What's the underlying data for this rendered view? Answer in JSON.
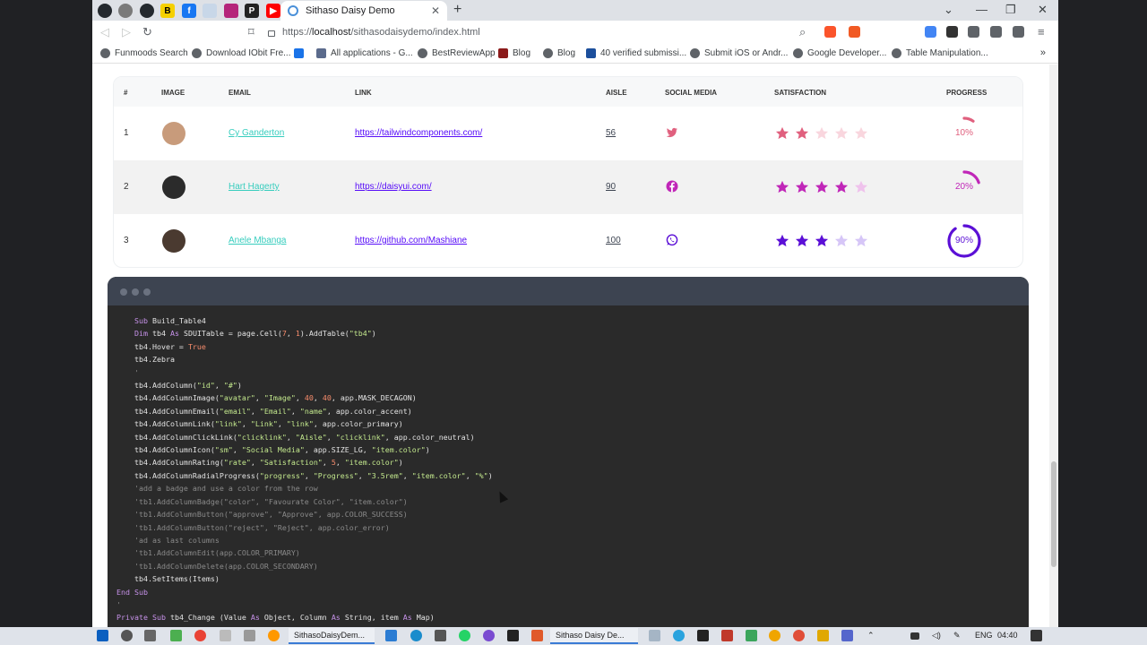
{
  "browser": {
    "tab_title": "Sithaso Daisy Demo",
    "url_prefix": "https://",
    "url_host": "localhost",
    "url_path": "/sithasodaisydemo/index.html",
    "bookmarks": [
      "Funmoods Search",
      "Download IObit Fre...",
      "All applications - G...",
      "BestReviewApp",
      "Blog",
      "Blog",
      "40 verified submissi...",
      "Submit iOS or Andr...",
      "Google Developer...",
      "Table Manipulation..."
    ]
  },
  "table": {
    "headers": [
      "#",
      "IMAGE",
      "EMAIL",
      "LINK",
      "AISLE",
      "SOCIAL MEDIA",
      "SATISFACTION",
      "PROGRESS"
    ],
    "rows": [
      {
        "id": "1",
        "email": "Cy Ganderton",
        "link": "https://tailwindcomponents.com/",
        "aisle": "56",
        "social": "twitter-icon",
        "rating": 2,
        "progress": 10,
        "progress_label": "10%",
        "color": "#e0607e",
        "light": "#f9d6de",
        "avatar_bg": "#c89b7b"
      },
      {
        "id": "2",
        "email": "Hart Hagerty",
        "link": "https://daisyui.com/",
        "aisle": "90",
        "social": "facebook-icon",
        "rating": 4,
        "progress": 20,
        "progress_label": "20%",
        "color": "#c026b8",
        "light": "#efc2ec",
        "avatar_bg": "#2b2b2b"
      },
      {
        "id": "3",
        "email": "Anele Mbanga",
        "link": "https://github.com/Mashiane",
        "aisle": "100",
        "social": "whatsapp-icon",
        "rating": 3,
        "progress": 90,
        "progress_label": "90%",
        "color": "#5b0fd6",
        "light": "#d6c6f7",
        "avatar_bg": "#4a3a30"
      }
    ]
  },
  "code_lines": [
    [
      [
        "kw",
        "Sub "
      ],
      [
        "",
        "Build_Table4"
      ]
    ],
    [
      [
        "kw",
        "Dim "
      ],
      [
        "",
        "tb4 "
      ],
      [
        "kw",
        "As "
      ],
      [
        "",
        "SDUITable = page.Cell("
      ],
      [
        "num",
        "7"
      ],
      [
        "",
        ", "
      ],
      [
        "num",
        "1"
      ],
      [
        "",
        ").AddTable("
      ],
      [
        "str",
        "\"tb4\""
      ],
      [
        "",
        ")"
      ]
    ],
    [
      [
        "",
        "tb4.Hover = "
      ],
      [
        "num",
        "True"
      ]
    ],
    [
      [
        "",
        "tb4.Zebra"
      ]
    ],
    [
      [
        "cm",
        "'"
      ]
    ],
    [
      [
        "",
        "tb4.AddColumn("
      ],
      [
        "str",
        "\"id\""
      ],
      [
        "",
        ", "
      ],
      [
        "str",
        "\"#\""
      ],
      [
        "",
        ")"
      ]
    ],
    [
      [
        "",
        "tb4.AddColumnImage("
      ],
      [
        "str",
        "\"avatar\""
      ],
      [
        "",
        ", "
      ],
      [
        "str",
        "\"Image\""
      ],
      [
        "",
        ", "
      ],
      [
        "num",
        "40"
      ],
      [
        "",
        ", "
      ],
      [
        "num",
        "40"
      ],
      [
        "",
        ", app.MASK_DECAGON)"
      ]
    ],
    [
      [
        "",
        "tb4.AddColumnEmail("
      ],
      [
        "str",
        "\"email\""
      ],
      [
        "",
        ", "
      ],
      [
        "str",
        "\"Email\""
      ],
      [
        "",
        ", "
      ],
      [
        "str",
        "\"name\""
      ],
      [
        "",
        ", app.color_accent)"
      ]
    ],
    [
      [
        "",
        "tb4.AddColumnLink("
      ],
      [
        "str",
        "\"link\""
      ],
      [
        "",
        ", "
      ],
      [
        "str",
        "\"Link\""
      ],
      [
        "",
        ", "
      ],
      [
        "str",
        "\"link\""
      ],
      [
        "",
        ", app.color_primary)"
      ]
    ],
    [
      [
        "",
        "tb4.AddColumnClickLink("
      ],
      [
        "str",
        "\"clicklink\""
      ],
      [
        "",
        ", "
      ],
      [
        "str",
        "\"Aisle\""
      ],
      [
        "",
        ", "
      ],
      [
        "str",
        "\"clicklink\""
      ],
      [
        "",
        ", app.color_neutral)"
      ]
    ],
    [
      [
        "",
        "tb4.AddColumnIcon("
      ],
      [
        "str",
        "\"sm\""
      ],
      [
        "",
        ", "
      ],
      [
        "str",
        "\"Social Media\""
      ],
      [
        "",
        ", app.SIZE_LG, "
      ],
      [
        "str",
        "\"item.color\""
      ],
      [
        "",
        ")"
      ]
    ],
    [
      [
        "",
        "tb4.AddColumnRating("
      ],
      [
        "str",
        "\"rate\""
      ],
      [
        "",
        ", "
      ],
      [
        "str",
        "\"Satisfaction\""
      ],
      [
        "",
        ", "
      ],
      [
        "num",
        "5"
      ],
      [
        "",
        ", "
      ],
      [
        "str",
        "\"item.color\""
      ],
      [
        "",
        ")"
      ]
    ],
    [
      [
        "",
        "tb4.AddColumnRadialProgress("
      ],
      [
        "str",
        "\"progress\""
      ],
      [
        "",
        ", "
      ],
      [
        "str",
        "\"Progress\""
      ],
      [
        "",
        ", "
      ],
      [
        "str",
        "\"3.5rem\""
      ],
      [
        "",
        ", "
      ],
      [
        "str",
        "\"item.color\""
      ],
      [
        "",
        ", "
      ],
      [
        "str",
        "\"%\""
      ],
      [
        "",
        ")"
      ]
    ],
    [
      [
        "cm",
        "'add a badge and use a color from the row"
      ]
    ],
    [
      [
        "cm",
        "'tb1.AddColumnBadge(\"color\", \"Favourate Color\", \"item.color\")"
      ]
    ],
    [
      [
        "cm",
        "'tb1.AddColumnButton(\"approve\", \"Approve\", app.COLOR_SUCCESS)"
      ]
    ],
    [
      [
        "cm",
        "'tb1.AddColumnButton(\"reject\", \"Reject\", app.color_error)"
      ]
    ],
    [
      [
        "cm",
        "'ad as last columns"
      ]
    ],
    [
      [
        "cm",
        "'tb1.AddColumnEdit(app.COLOR_PRIMARY)"
      ]
    ],
    [
      [
        "cm",
        "'tb1.AddColumnDelete(app.COLOR_SECONDARY)"
      ]
    ],
    [
      [
        "",
        "tb4.SetItems(Items)"
      ]
    ],
    [
      [
        "kw",
        "End Sub"
      ]
    ],
    [
      [
        "cm",
        "'"
      ]
    ],
    [
      [
        "kw",
        "Private Sub "
      ],
      [
        "",
        "tb4_Change (Value "
      ],
      [
        "kw",
        "As "
      ],
      [
        "",
        "Object, Column "
      ],
      [
        "kw",
        "As "
      ],
      [
        "",
        "String, item "
      ],
      [
        "kw",
        "As "
      ],
      [
        "",
        "Map)"
      ]
    ]
  ],
  "taskbar": {
    "app1": "SithasoDaisyDem...",
    "app2": "Sithaso Daisy De...",
    "lang": "ENG",
    "time": "04:40"
  }
}
